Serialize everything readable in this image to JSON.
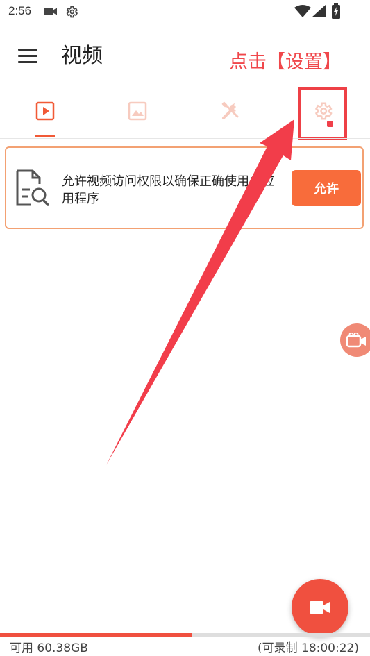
{
  "status_bar": {
    "time": "2:56",
    "icons": [
      "videocam-icon",
      "gear-icon",
      "wifi-icon",
      "signal-icon",
      "battery-icon"
    ]
  },
  "header": {
    "title": "视频",
    "menu_icon": "hamburger-menu-icon"
  },
  "annotation": {
    "text": "点击【设置】",
    "color": "#f0474b"
  },
  "tabs": [
    {
      "icon": "video-play-icon",
      "selected": true
    },
    {
      "icon": "image-icon",
      "selected": false
    },
    {
      "icon": "tools-icon",
      "selected": false
    },
    {
      "icon": "settings-gear-icon",
      "selected": false,
      "badge": true
    }
  ],
  "permission_card": {
    "message": "允许视频访问权限以确保正确使用此应用程序",
    "button_label": "允许",
    "icon": "document-search-icon"
  },
  "storage": {
    "available": "可用 60.38GB",
    "record_time": "(可录制 18:00:22)",
    "used_fraction": 0.52
  },
  "colors": {
    "accent": "#f0503f",
    "button": "#f86c3b",
    "card_border": "#f3a173",
    "tab_inactive": "#f7cbbf"
  }
}
